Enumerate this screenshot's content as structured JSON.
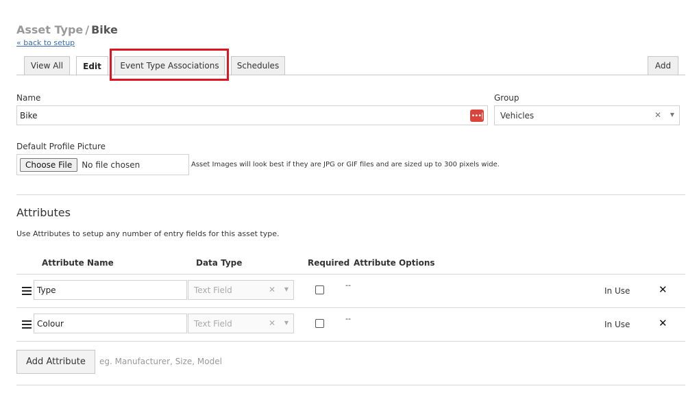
{
  "header": {
    "crumb": "Asset Type",
    "separator": "/",
    "current": "Bike",
    "back_link": "« back to setup"
  },
  "tabs": [
    {
      "label": "View All"
    },
    {
      "label": "Edit"
    },
    {
      "label": "Event Type Associations"
    },
    {
      "label": "Schedules"
    },
    {
      "label": "Add"
    }
  ],
  "form": {
    "name_label": "Name",
    "name_value": "Bike",
    "group_label": "Group",
    "group_value": "Vehicles",
    "picture_label": "Default Profile Picture",
    "choose_file": "Choose File",
    "no_file": "No file chosen",
    "picture_hint": "Asset Images will look best if they are JPG or GIF files and are sized up to 300 pixels wide."
  },
  "attributes": {
    "title": "Attributes",
    "description": "Use Attributes to setup any number of entry fields for this asset type.",
    "headers": {
      "name": "Attribute Name",
      "type": "Data Type",
      "required": "Required",
      "options": "Attribute Options"
    },
    "rows": [
      {
        "name": "Type",
        "data_type": "Text Field",
        "options": "--",
        "status": "In Use"
      },
      {
        "name": "Colour",
        "data_type": "Text Field",
        "options": "--",
        "status": "In Use"
      }
    ],
    "add_button": "Add Attribute",
    "add_hint": "eg. Manufacturer, Size, Model"
  },
  "icons": {
    "clear": "✕",
    "caret": "▼",
    "delete": "✕",
    "password_manager": "•••|"
  },
  "colors": {
    "highlight": "#e0141e",
    "password_icon": "#d9453d",
    "link": "#3a6bb5"
  }
}
